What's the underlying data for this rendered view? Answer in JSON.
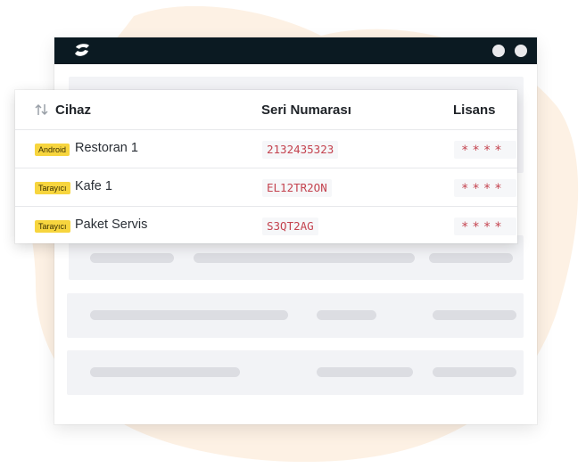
{
  "table": {
    "headers": {
      "device": "Cihaz",
      "serial": "Seri Numarası",
      "license": "Lisans"
    },
    "sort_icon": "sort-arrows-icon",
    "rows": [
      {
        "badge": "Android",
        "name": "Restoran 1",
        "serial": "2132435323",
        "license": "****"
      },
      {
        "badge": "Tarayıcı",
        "name": "Kafe 1",
        "serial": "EL12TR2ON",
        "license": "****"
      },
      {
        "badge": "Tarayıcı",
        "name": "Paket Servis",
        "serial": "S3QT2AG",
        "license": "****"
      }
    ]
  },
  "colors": {
    "titlebar": "#0b1a22",
    "badge": "#f7d53e",
    "serial_text": "#c4434f",
    "blob": "#fdf1e4"
  }
}
